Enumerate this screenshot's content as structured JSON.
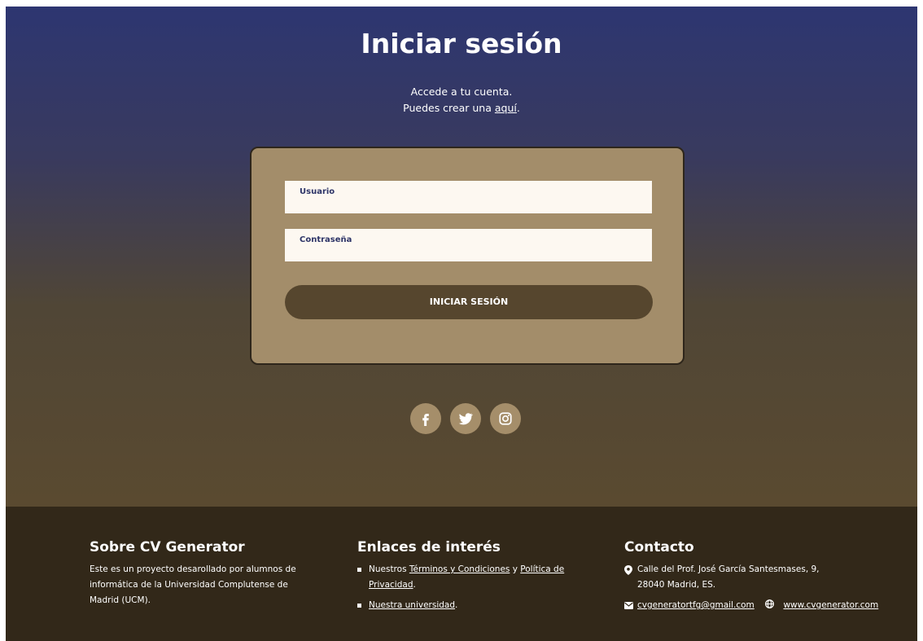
{
  "page": {
    "title": "Iniciar sesión",
    "subtitle_line1": "Accede a tu cuenta.",
    "subtitle_line2_prefix": "Puedes crear una ",
    "subtitle_link": "aquí",
    "subtitle_line2_suffix": "."
  },
  "form": {
    "username_label": "Usuario",
    "password_label": "Contraseña",
    "submit_label": "INICIAR SESIÓN"
  },
  "social": [
    {
      "icon": "facebook-icon"
    },
    {
      "icon": "twitter-icon"
    },
    {
      "icon": "instagram-icon"
    }
  ],
  "footer": {
    "about": {
      "heading": "Sobre CV Generator",
      "text_line1": "Este es un proyecto desarollado por alumnos de",
      "text_line2": "informática de la Universidad Complutense de",
      "text_line3": "Madrid (UCM)."
    },
    "links": {
      "heading": "Enlaces de interés",
      "item1_prefix": "Nuestros ",
      "item1_link1": "Términos y Condiciones",
      "item1_middle": " y ",
      "item1_link2_part1": "Política de",
      "item1_link2_part2": "Privacidad",
      "item1_suffix": ".",
      "item2_link": "Nuestra universidad",
      "item2_suffix": "."
    },
    "contact": {
      "heading": "Contacto",
      "address_line1": "Calle del Prof. José García Santesmases, 9,",
      "address_line2": "28040 Madrid, ES.",
      "email": "cvgeneratortfg@gmail.com",
      "website": "www.cvgenerator.com"
    }
  },
  "colors": {
    "accent_dark": "#56462e",
    "card": "#a38d6a",
    "footer": "#322819",
    "label": "#2e3568"
  }
}
